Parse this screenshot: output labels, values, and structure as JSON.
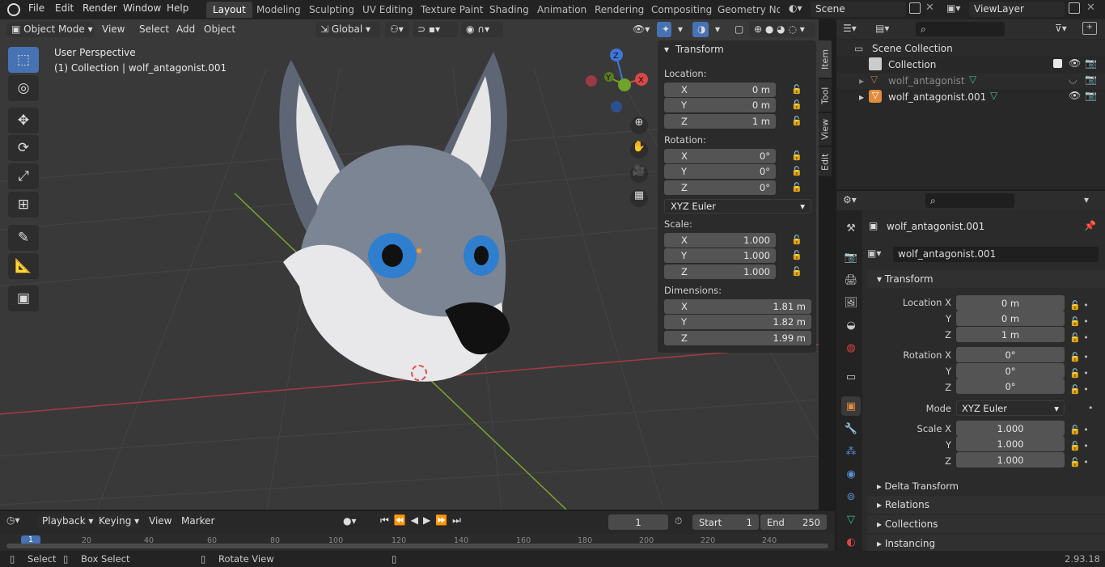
{
  "menu": {
    "items": [
      "File",
      "Edit",
      "Render",
      "Window",
      "Help"
    ]
  },
  "workspaces": [
    "Layout",
    "Modeling",
    "Sculpting",
    "UV Editing",
    "Texture Paint",
    "Shading",
    "Animation",
    "Rendering",
    "Compositing",
    "Geometry Nod"
  ],
  "scene": {
    "name": "Scene",
    "view_layer": "ViewLayer"
  },
  "viewport": {
    "mode": "Object Mode",
    "view": "View",
    "select": "Select",
    "add": "Add",
    "object": "Object",
    "orientation": "Global",
    "overlay_title": "User Perspective",
    "overlay_sub": "(1) Collection | wolf_antagonist.001",
    "gizmo": {
      "z": "Z",
      "y": "Y",
      "x": "X"
    }
  },
  "npanel": {
    "title": "Transform",
    "location_label": "Location:",
    "loc": [
      "0 m",
      "0 m",
      "1 m"
    ],
    "rotation_label": "Rotation:",
    "rot": [
      "0°",
      "0°",
      "0°"
    ],
    "rot_mode": "XYZ Euler",
    "scale_label": "Scale:",
    "scale": [
      "1.000",
      "1.000",
      "1.000"
    ],
    "dim_label": "Dimensions:",
    "dim": [
      "1.81 m",
      "1.82 m",
      "1.99 m"
    ],
    "axes": [
      "X",
      "Y",
      "Z"
    ],
    "tabs": [
      "Item",
      "Tool",
      "View",
      "Edit"
    ]
  },
  "outliner": {
    "root": "Scene Collection",
    "collection": "Collection",
    "obj1": "wolf_antagonist",
    "obj2": "wolf_antagonist.001"
  },
  "properties": {
    "object_name": "wolf_antagonist.001",
    "data_name": "wolf_antagonist.001",
    "transform": "Transform",
    "loc_x": "Location X",
    "y": "Y",
    "z": "Z",
    "loc": [
      "0 m",
      "0 m",
      "1 m"
    ],
    "rot_x": "Rotation X",
    "rot": [
      "0°",
      "0°",
      "0°"
    ],
    "mode_label": "Mode",
    "mode": "XYZ Euler",
    "scale_x": "Scale X",
    "scale": [
      "1.000",
      "1.000",
      "1.000"
    ],
    "delta": "Delta Transform",
    "relations": "Relations",
    "collections": "Collections",
    "instancing": "Instancing"
  },
  "timeline": {
    "playback": "Playback",
    "keying": "Keying",
    "view": "View",
    "marker": "Marker",
    "frame": "1",
    "start_label": "Start",
    "start": "1",
    "end_label": "End",
    "end": "250",
    "ruler": [
      "1",
      "20",
      "40",
      "60",
      "80",
      "100",
      "120",
      "140",
      "160",
      "180",
      "200",
      "220",
      "240"
    ]
  },
  "status": {
    "select": "Select",
    "box_select": "Box Select",
    "rotate_view": "Rotate View",
    "version": "2.93.18"
  },
  "colors": {
    "accent": "#4772b3",
    "bg": "#393939",
    "panel": "#2b2b2b",
    "axis_red": "#a53a45",
    "axis_green": "#7fa330"
  }
}
